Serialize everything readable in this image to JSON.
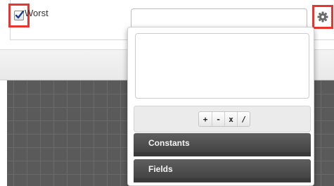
{
  "criteria_row": {
    "checkbox_checked": true,
    "label": "Worst",
    "formula_value": ""
  },
  "formula_builder": {
    "operators": [
      "+",
      "-",
      "x",
      "/"
    ],
    "sections": [
      {
        "label": "Constants"
      },
      {
        "label": "Fields"
      }
    ]
  },
  "colors": {
    "highlight": "#e8362e",
    "section_header": "#4f4f4f",
    "canvas": "#5a5a5a"
  },
  "icons": {
    "checkbox": "checkmark-icon",
    "settings": "gear-icon"
  }
}
